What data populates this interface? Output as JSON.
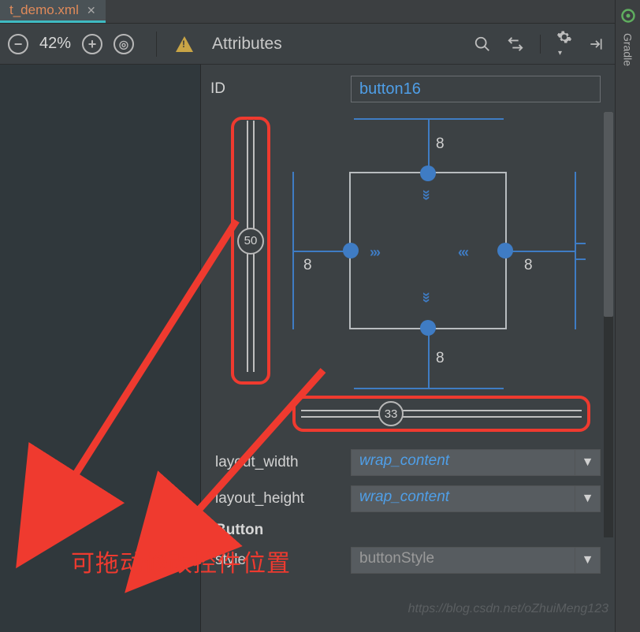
{
  "tab": {
    "name": "t_demo.xml"
  },
  "toolbar": {
    "zoom": "42%"
  },
  "rightRail": {
    "label": "Gradle"
  },
  "attributes": {
    "title": "Attributes",
    "id": {
      "label": "ID",
      "value": "button16"
    },
    "constraint": {
      "vbias": "50",
      "hbias": "33",
      "margin_top": "8",
      "margin_bottom": "8",
      "margin_left": "8",
      "margin_right": "8"
    },
    "layout_width": {
      "label": "layout_width",
      "value": "wrap_content"
    },
    "layout_height": {
      "label": "layout_height",
      "value": "wrap_content"
    },
    "section": "Button",
    "style": {
      "label": "style",
      "value": "buttonStyle"
    }
  },
  "annotation": "可拖动修改控件位置",
  "watermark": "https://blog.csdn.net/oZhuiMeng123"
}
